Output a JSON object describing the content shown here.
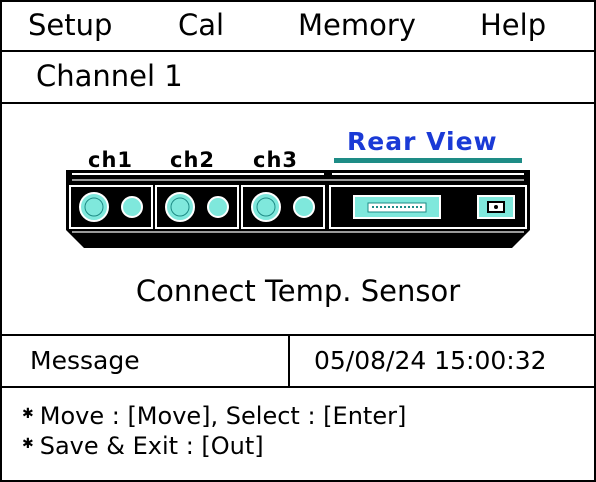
{
  "menu": {
    "items": [
      {
        "label": "Setup"
      },
      {
        "label": "Cal"
      },
      {
        "label": "Memory"
      },
      {
        "label": "Help"
      }
    ]
  },
  "channel": {
    "title": "Channel 1"
  },
  "diagram": {
    "view_label": "Rear View",
    "channels": [
      "ch1",
      "ch2",
      "ch3"
    ],
    "colors": {
      "connector": "#7fe8dc",
      "accent": "#1a3ad6",
      "teal_strip": "#1e8c86",
      "body": "#000000"
    }
  },
  "status": {
    "text": "Connect Temp. Sensor"
  },
  "message": {
    "label": "Message",
    "datetime": "05/08/24 15:00:32"
  },
  "help": {
    "lines": [
      "Move : [Move], Select : [Enter]",
      "Save & Exit : [Out]"
    ]
  }
}
